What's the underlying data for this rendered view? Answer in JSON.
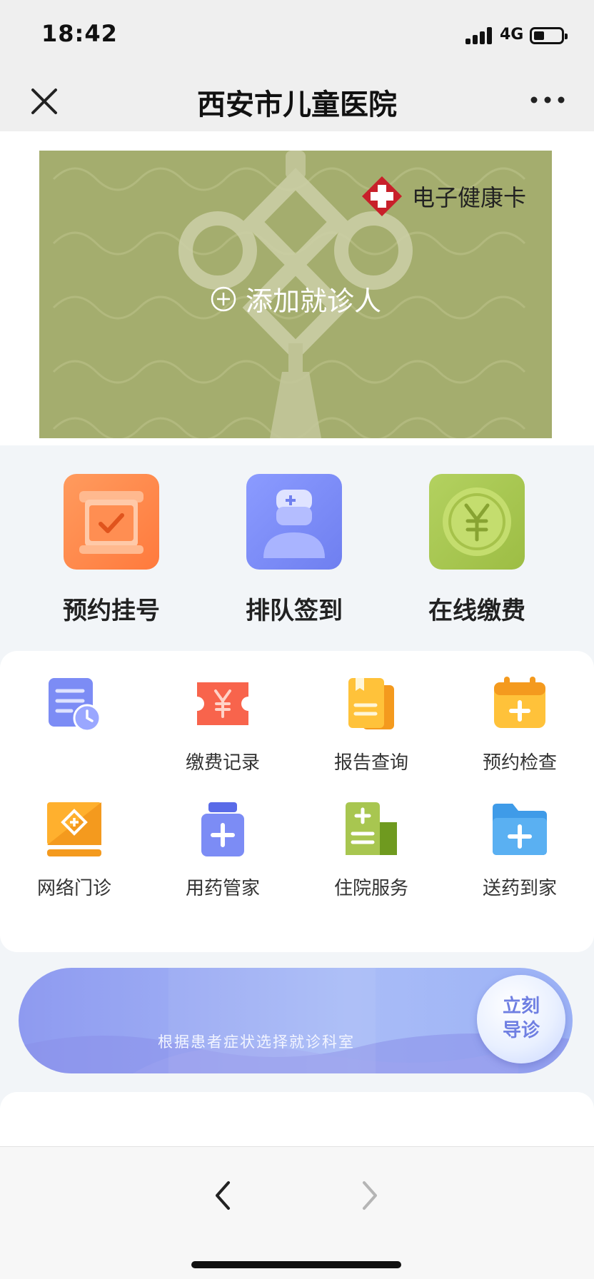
{
  "status_bar": {
    "time": "18:42",
    "network": "4G"
  },
  "nav": {
    "title": "西安市儿童医院"
  },
  "health_card": {
    "brand": "电子健康卡",
    "add_patient": "添加就诊人"
  },
  "quick_actions": [
    {
      "label": "预约挂号",
      "icon": "calendar-check-icon",
      "color": "#ff8a4d"
    },
    {
      "label": "排队签到",
      "icon": "doctor-icon",
      "color": "#7c8cf5"
    },
    {
      "label": "在线缴费",
      "icon": "yen-coin-icon",
      "color": "#a8c650"
    }
  ],
  "services": [
    {
      "label": "",
      "icon": "list-clock-icon"
    },
    {
      "label": "缴费记录",
      "icon": "yen-ticket-icon"
    },
    {
      "label": "报告查询",
      "icon": "report-icon"
    },
    {
      "label": "预约检查",
      "icon": "calendar-plus-icon"
    },
    {
      "label": "网络门诊",
      "icon": "laptop-medical-icon"
    },
    {
      "label": "用药管家",
      "icon": "medicine-bottle-icon"
    },
    {
      "label": "住院服务",
      "icon": "hospital-doc-icon"
    },
    {
      "label": "送药到家",
      "icon": "folder-plus-icon"
    }
  ],
  "guide": {
    "text": "根据患者症状选择就诊科室",
    "button_line1": "立刻",
    "button_line2": "导诊"
  },
  "colors": {
    "card_bg": "#a4ad6e",
    "accent_blue": "#8e9af0",
    "brand_red": "#c8202a"
  }
}
